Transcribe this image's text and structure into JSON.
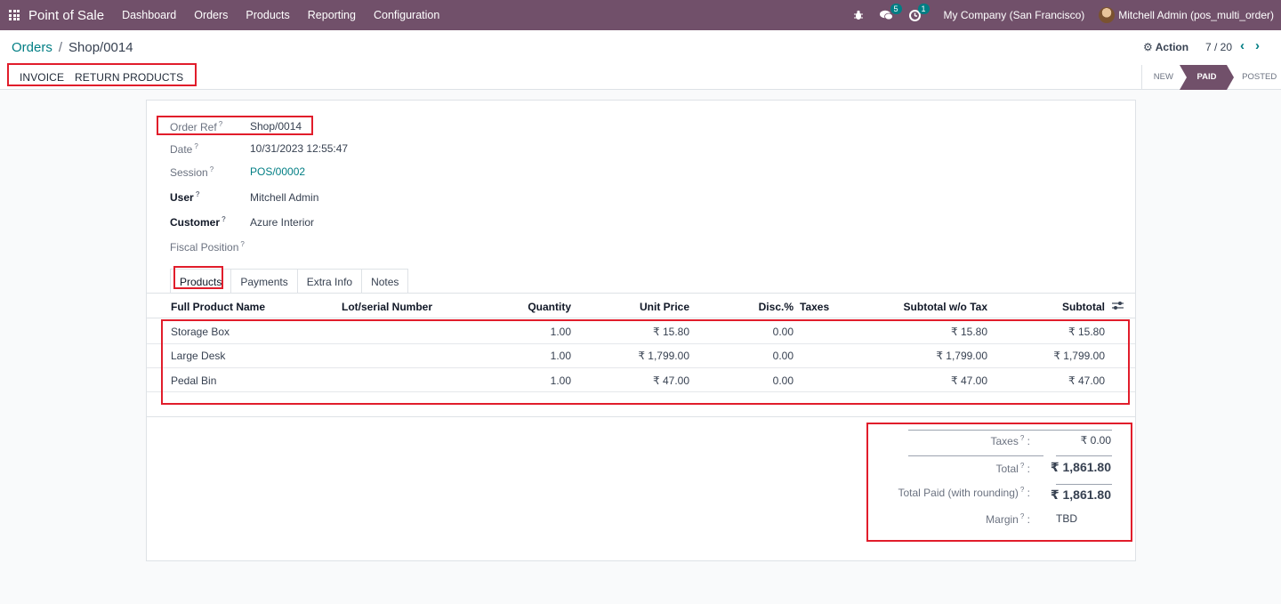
{
  "navbar": {
    "app_name": "Point of Sale",
    "menu": [
      "Dashboard",
      "Orders",
      "Products",
      "Reporting",
      "Configuration"
    ],
    "chat_count": "5",
    "activity_count": "1",
    "company": "My Company (San Francisco)",
    "user": "Mitchell Admin (pos_multi_order)"
  },
  "breadcrumb": {
    "parent": "Orders",
    "separator": "/",
    "current": "Shop/0014"
  },
  "control": {
    "action_label": "Action",
    "pager": "7 / 20"
  },
  "buttons": {
    "invoice": "INVOICE",
    "return_products": "RETURN PRODUCTS"
  },
  "statusbar": {
    "stages": [
      "NEW",
      "PAID",
      "POSTED"
    ],
    "active": "PAID"
  },
  "form": {
    "order_ref": {
      "label": "Order Ref",
      "value": "Shop/0014"
    },
    "date": {
      "label": "Date",
      "value": "10/31/2023 12:55:47"
    },
    "session": {
      "label": "Session",
      "value": "POS/00002"
    },
    "user": {
      "label": "User",
      "value": "Mitchell Admin"
    },
    "customer": {
      "label": "Customer",
      "value": "Azure Interior"
    },
    "fiscal_position": {
      "label": "Fiscal Position",
      "value": ""
    },
    "help_mark": "?"
  },
  "tabs": [
    "Products",
    "Payments",
    "Extra Info",
    "Notes"
  ],
  "table": {
    "headers": [
      "Full Product Name",
      "Lot/serial Number",
      "Quantity",
      "Unit Price",
      "Disc.%",
      "Taxes",
      "Subtotal w/o Tax",
      "Subtotal"
    ],
    "rows": [
      {
        "name": "Storage Box",
        "lot": "",
        "qty": "1.00",
        "unit_price": "₹ 15.80",
        "disc": "0.00",
        "taxes": "",
        "subtotal_wo_tax": "₹ 15.80",
        "subtotal": "₹ 15.80"
      },
      {
        "name": "Large Desk",
        "lot": "",
        "qty": "1.00",
        "unit_price": "₹ 1,799.00",
        "disc": "0.00",
        "taxes": "",
        "subtotal_wo_tax": "₹ 1,799.00",
        "subtotal": "₹ 1,799.00"
      },
      {
        "name": "Pedal Bin",
        "lot": "",
        "qty": "1.00",
        "unit_price": "₹ 47.00",
        "disc": "0.00",
        "taxes": "",
        "subtotal_wo_tax": "₹ 47.00",
        "subtotal": "₹ 47.00"
      }
    ]
  },
  "totals": {
    "taxes": {
      "label": "Taxes",
      "value": "₹ 0.00"
    },
    "total": {
      "label": "Total",
      "value": "₹ 1,861.80"
    },
    "total_paid": {
      "label": "Total Paid (with rounding)",
      "value": "₹ 1,861.80"
    },
    "margin": {
      "label": "Margin",
      "value": "TBD"
    },
    "colon": ":"
  },
  "colors": {
    "navbar": "#71506a",
    "link": "#017e84",
    "highlight": "#e11d2b"
  }
}
